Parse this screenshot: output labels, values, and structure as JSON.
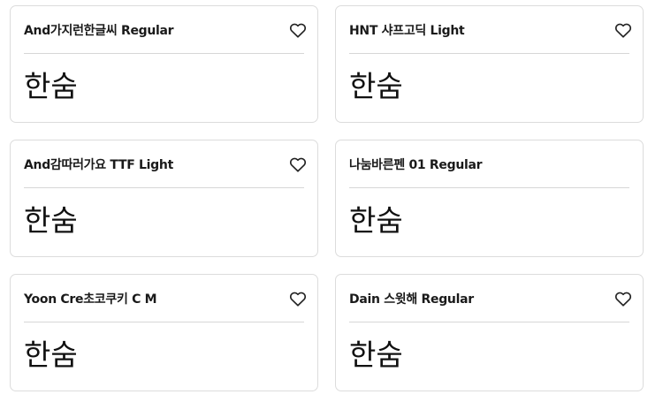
{
  "preview_text": "한숨",
  "icons": {
    "favorite": "heart-outline-icon"
  },
  "cards": [
    {
      "name": "And가지런한글씨 Regular"
    },
    {
      "name": "HNT 샤프고딕 Light"
    },
    {
      "name": "And감따러가요 TTF Light"
    },
    {
      "name": "나눔바른펜 01 Regular"
    },
    {
      "name": "Yoon Cre초코쿠키 C M"
    },
    {
      "name": "Dain 스윗해 Regular"
    }
  ]
}
